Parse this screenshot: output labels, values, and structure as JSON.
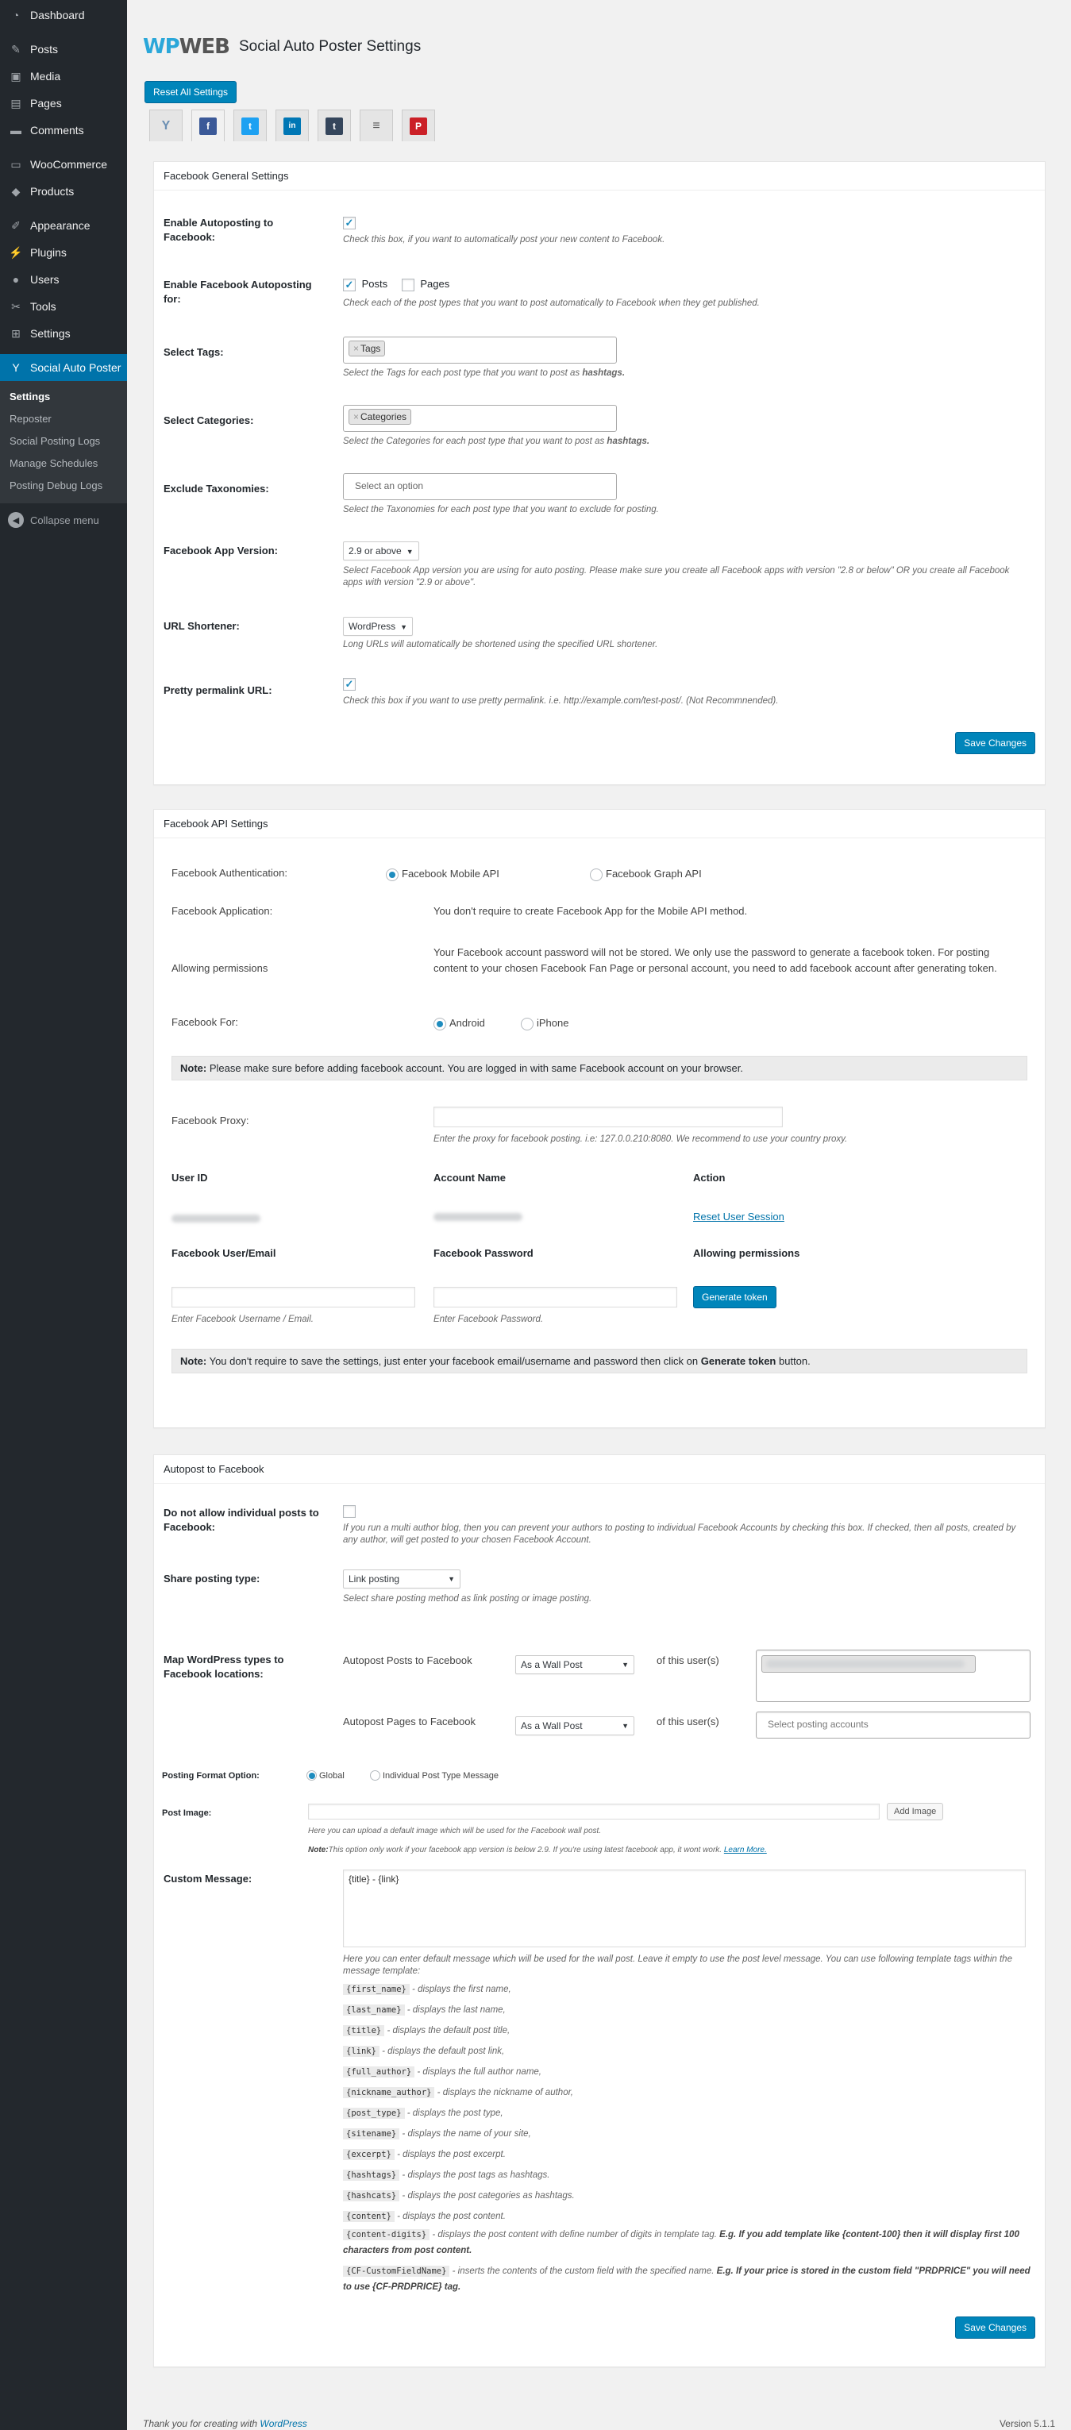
{
  "sidebar": {
    "menu": [
      {
        "label": "Dashboard",
        "icon": "dashboard-icon"
      },
      {
        "label": "Posts",
        "icon": "pin-icon"
      },
      {
        "label": "Media",
        "icon": "media-icon"
      },
      {
        "label": "Pages",
        "icon": "page-icon"
      },
      {
        "label": "Comments",
        "icon": "comment-icon"
      },
      {
        "label": "WooCommerce",
        "icon": "woocommerce-icon"
      },
      {
        "label": "Products",
        "icon": "box-icon"
      },
      {
        "label": "Appearance",
        "icon": "brush-icon"
      },
      {
        "label": "Plugins",
        "icon": "plug-icon"
      },
      {
        "label": "Users",
        "icon": "users-icon"
      },
      {
        "label": "Tools",
        "icon": "wrench-icon"
      },
      {
        "label": "Settings",
        "icon": "settings-icon"
      },
      {
        "label": "Social Auto Poster",
        "icon": "social-auto-poster-icon"
      }
    ],
    "submenu": [
      "Settings",
      "Reposter",
      "Social Posting Logs",
      "Manage Schedules",
      "Posting Debug Logs"
    ],
    "collapse": "Collapse menu"
  },
  "header": {
    "logo_wp": "WP",
    "logo_web": "WEB",
    "title": "Social Auto Poster Settings",
    "reset_button": "Reset All Settings"
  },
  "tabs": [
    {
      "name": "general",
      "glyph": "Y",
      "color": "#6b8fb3"
    },
    {
      "name": "facebook",
      "glyph": "f",
      "color": "#3b5998"
    },
    {
      "name": "twitter",
      "glyph": "t",
      "color": "#1da1f2"
    },
    {
      "name": "linkedin",
      "glyph": "in",
      "color": "#0077b5"
    },
    {
      "name": "tumblr",
      "glyph": "t",
      "color": "#35465c"
    },
    {
      "name": "buffer",
      "glyph": "≡",
      "color": "#555555"
    },
    {
      "name": "pinterest",
      "glyph": "P",
      "color": "#cb2027"
    }
  ],
  "general": {
    "title": "Facebook General Settings",
    "enable_label": "Enable Autoposting to Facebook:",
    "enable_desc": "Check this box, if you want to automatically post your new content to Facebook.",
    "enable_for_label": "Enable Facebook Autoposting for:",
    "posts": "Posts",
    "pages": "Pages",
    "enable_for_desc": "Check each of the post types that you want to post automatically to Facebook when they get published.",
    "tags_label": "Select Tags:",
    "tags_chip": "Tags",
    "tags_desc_pre": "Select the Tags for each post type that you want to post as ",
    "tags_desc_bold": "hashtags.",
    "categories_label": "Select Categories:",
    "categories_chip": "Categories",
    "categories_desc_pre": "Select the Categories for each post type that you want to post as ",
    "categories_desc_bold": "hashtags.",
    "exclude_label": "Exclude Taxonomies:",
    "exclude_placeholder": "Select an option",
    "exclude_desc": "Select the Taxonomies for each post type that you want to exclude for posting.",
    "app_version_label": "Facebook App Version:",
    "app_version_value": "2.9 or above",
    "app_version_desc": "Select Facebook App version you are using for auto posting. Please make sure you create all Facebook apps with version \"2.8 or below\" OR you create all Facebook apps with version \"2.9 or above\".",
    "shortener_label": "URL Shortener:",
    "shortener_value": "WordPress",
    "shortener_desc": "Long URLs will automatically be shortened using the specified URL shortener.",
    "pretty_label": "Pretty permalink URL:",
    "pretty_desc": "Check this box if you want to use pretty permalink. i.e. http://example.com/test-post/. (Not Recommnended).",
    "save": "Save Changes"
  },
  "api": {
    "title": "Facebook API Settings",
    "auth_label": "Facebook Authentication:",
    "auth_mobile": "Facebook Mobile API",
    "auth_graph": "Facebook Graph API",
    "app_label": "Facebook Application:",
    "app_text": "You don't require to create Facebook App for the Mobile API method.",
    "perm_label": "Allowing permissions",
    "perm_text": "Your Facebook account password will not be stored. We only use the password to generate a facebook token. For posting content to your chosen Facebook Fan Page or personal account, you need to add facebook account after generating token.",
    "for_label": "Facebook For:",
    "for_android": "Android",
    "for_iphone": "iPhone",
    "note1_bold": "Note:",
    "note1_text": " Please make sure before adding facebook account. You are logged in with same Facebook account on your browser.",
    "proxy_label": "Facebook Proxy:",
    "proxy_desc": "Enter the proxy for facebook posting. i.e: 127.0.0.210:8080. We recommend to use your country proxy.",
    "col_user_id": "User ID",
    "col_account": "Account Name",
    "col_action": "Action",
    "reset_session": "Reset User Session",
    "col_user_email": "Facebook User/Email",
    "col_password": "Facebook Password",
    "col_permissions": "Allowing permissions",
    "user_desc": "Enter Facebook Username / Email.",
    "pass_desc": "Enter Facebook Password.",
    "generate": "Generate token",
    "note2_bold": "Note:",
    "note2_pre": " You don't require to save the settings, just enter your facebook email/username and password then click on ",
    "note2_bold2": "Generate token",
    "note2_post": " button."
  },
  "autopost": {
    "title": "Autopost to Facebook",
    "individual_label": "Do not allow individual posts to Facebook:",
    "individual_desc": "If you run a multi author blog, then you can prevent your authors to posting to individual Facebook Accounts by checking this box. If checked, then all posts, created by any author, will get posted to your chosen Facebook Account.",
    "share_label": "Share posting type:",
    "share_value": "Link posting",
    "share_desc": "Select share posting method as link posting or image posting.",
    "map_label": "Map WordPress types to Facebook locations:",
    "posts_to": "Autopost Posts to Facebook",
    "pages_to": "Autopost Pages to Facebook",
    "wall_post": "As a Wall Post",
    "of_user": "of this user(s)",
    "select_accounts": "Select posting accounts",
    "format_label": "Posting Format Option:",
    "format_global": "Global",
    "format_individual": "Individual Post Type Message",
    "image_label": "Post Image:",
    "add_image": "Add Image",
    "image_desc": "Here you can upload a default image which will be used for the Facebook wall post.",
    "image_note_bold": "Note:",
    "image_note": "This option only work if your facebook app version is below 2.9. If you're using latest facebook app, it wont work. ",
    "learn_more": "Learn More.",
    "custom_label": "Custom Message:",
    "custom_value": "{title} - {link}",
    "custom_desc": "Here you can enter default message which will be used for the wall post. Leave it empty to use the post level message. You can use following template tags within the message template:",
    "template_tags": [
      {
        "tag": "{first_name}",
        "desc": " - displays the first name,",
        "extra": ""
      },
      {
        "tag": "{last_name}",
        "desc": " - displays the last name,",
        "extra": ""
      },
      {
        "tag": "{title}",
        "desc": " - displays the default post title,",
        "extra": ""
      },
      {
        "tag": "{link}",
        "desc": " - displays the default post link,",
        "extra": ""
      },
      {
        "tag": "{full_author}",
        "desc": " - displays the full author name,",
        "extra": ""
      },
      {
        "tag": "{nickname_author}",
        "desc": " - displays the nickname of author,",
        "extra": ""
      },
      {
        "tag": "{post_type}",
        "desc": " - displays the post type,",
        "extra": ""
      },
      {
        "tag": "{sitename}",
        "desc": " - displays the name of your site,",
        "extra": ""
      },
      {
        "tag": "{excerpt}",
        "desc": " - displays the post excerpt.",
        "extra": ""
      },
      {
        "tag": "{hashtags}",
        "desc": " - displays the post tags as hashtags.",
        "extra": ""
      },
      {
        "tag": "{hashcats}",
        "desc": " - displays the post categories as hashtags.",
        "extra": ""
      },
      {
        "tag": "{content}",
        "desc": " - displays the post content.",
        "extra": ""
      },
      {
        "tag": "{content-digits}",
        "desc": " - displays the post content with define number of digits in template tag. ",
        "extra": "E.g. If you add template like {content-100} then it will display first 100 characters from post content."
      },
      {
        "tag": "{CF-CustomFieldName}",
        "desc": " - inserts the contents of the custom field with the specified name. ",
        "extra": "E.g. If your price is stored in the custom field \"PRDPRICE\" you will need to use {CF-PRDPRICE} tag."
      }
    ],
    "save": "Save Changes"
  },
  "footer": {
    "thanks": "Thank you for creating with ",
    "wordpress": "WordPress",
    "version": "Version 5.1.1"
  }
}
